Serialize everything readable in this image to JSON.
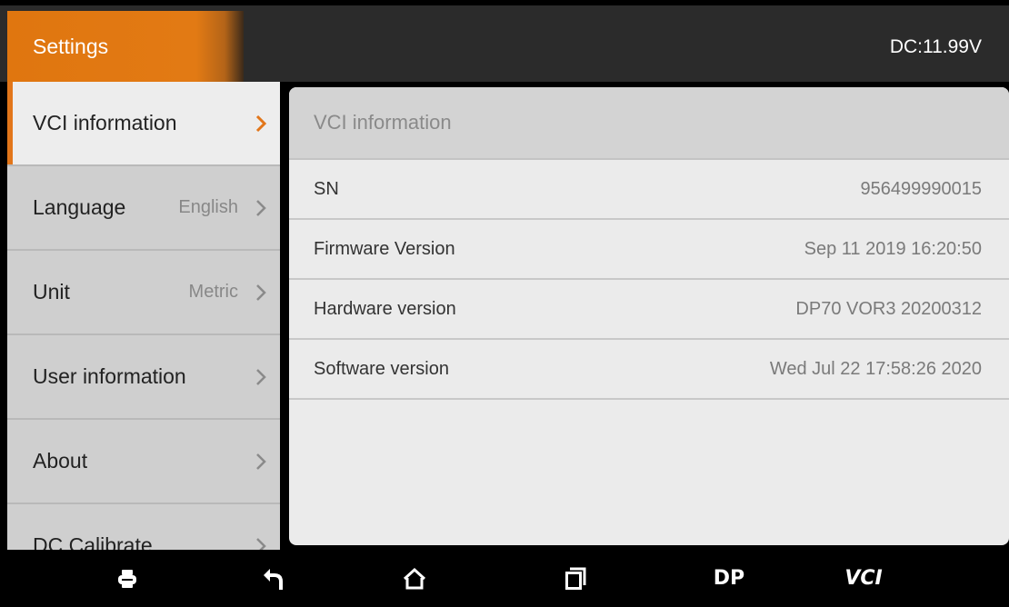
{
  "header": {
    "title": "Settings",
    "voltage": "DC:11.99V"
  },
  "sidebar": {
    "items": [
      {
        "label": "VCI information",
        "value": "",
        "active": true
      },
      {
        "label": "Language",
        "value": "English",
        "active": false
      },
      {
        "label": "Unit",
        "value": "Metric",
        "active": false
      },
      {
        "label": "User information",
        "value": "",
        "active": false
      },
      {
        "label": "About",
        "value": "",
        "active": false
      },
      {
        "label": "DC Calibrate",
        "value": "",
        "active": false
      }
    ]
  },
  "panel": {
    "title": "VCI information",
    "rows": [
      {
        "key": "SN",
        "value": "956499990015"
      },
      {
        "key": "Firmware Version",
        "value": "Sep 11 2019 16:20:50"
      },
      {
        "key": "Hardware version",
        "value": "DP70 VOR3 20200312"
      },
      {
        "key": "Software version",
        "value": "Wed Jul 22 17:58:26 2020"
      }
    ]
  },
  "navbar": {
    "items": [
      {
        "icon": "printer-icon"
      },
      {
        "icon": "back-icon"
      },
      {
        "icon": "home-icon"
      },
      {
        "icon": "recent-apps-icon"
      },
      {
        "label": "DP"
      },
      {
        "label": "VCI"
      }
    ]
  },
  "colors": {
    "accent": "#e2761a",
    "titlebar": "#2b2b2b",
    "sidebar": "#cfcfcf",
    "panel": "#ebebeb"
  }
}
